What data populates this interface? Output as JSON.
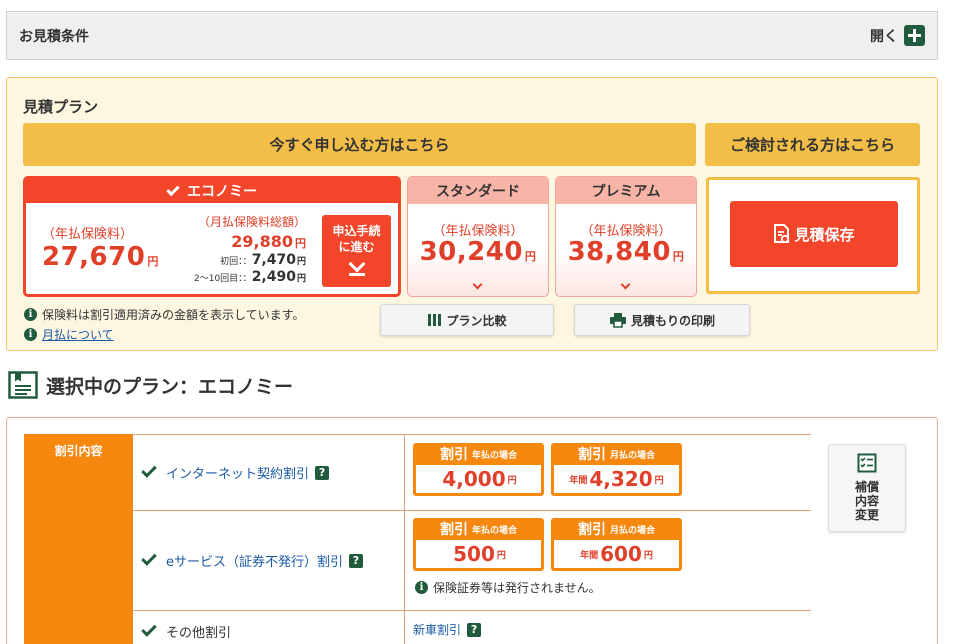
{
  "conditions": {
    "title": "お見積条件",
    "open_label": "開く"
  },
  "plan_panel": {
    "title": "見積プラン",
    "apply_header": "今すぐ申し込む方はこちら",
    "consider_header": "ご検討される方はこちら",
    "selected_plan": {
      "name": "エコノミー",
      "annual_label": "（年払保険料）",
      "annual_price": "27,670",
      "monthly_label": "（月払保険料総額）",
      "monthly_total": "29,880",
      "first_label": "初回：：",
      "first_price": "7,470",
      "rest_label": "2～10回目：：",
      "rest_price": "2,490",
      "yen": "円",
      "apply_button_line1": "申込手続",
      "apply_button_line2": "に進む"
    },
    "other_plans": [
      {
        "name": "スタンダード",
        "annual_label": "（年払保険料）",
        "annual_price": "30,240"
      },
      {
        "name": "プレミアム",
        "annual_label": "（年払保険料）",
        "annual_price": "38,840"
      }
    ],
    "save_button": "見積保存",
    "notes": [
      {
        "text": "保険料は割引適用済みの金額を表示しています。"
      },
      {
        "text": "月払について"
      }
    ],
    "compare_button": "プラン比較",
    "print_button": "見積もりの印刷"
  },
  "selected_section": {
    "title": "選択中のプラン：エコノミー"
  },
  "discounts": {
    "side_label": "割引内容",
    "rows": [
      {
        "name": "インターネット契約割引",
        "annual_badge": {
          "big": "割引",
          "small": "年払の場合",
          "value": "4,000",
          "prefix": ""
        },
        "monthly_badge": {
          "big": "割引",
          "small": "月払の場合",
          "value": "4,320",
          "prefix": "年間"
        }
      },
      {
        "name": "eサービス（証券不発行）割引",
        "annual_badge": {
          "big": "割引",
          "small": "年払の場合",
          "value": "500",
          "prefix": ""
        },
        "monthly_badge": {
          "big": "割引",
          "small": "月払の場合",
          "value": "600",
          "prefix": "年間"
        },
        "note": "保険証券等は発行されません。"
      },
      {
        "name": "その他割引",
        "link": "新車割引"
      }
    ],
    "coverage_button": "補償\n内容\n変更"
  },
  "colors": {
    "brand_green": "#1f5b3c",
    "accent_red": "#f2452a",
    "accent_orange": "#f6870f",
    "panel_yellow": "#f3be48"
  }
}
